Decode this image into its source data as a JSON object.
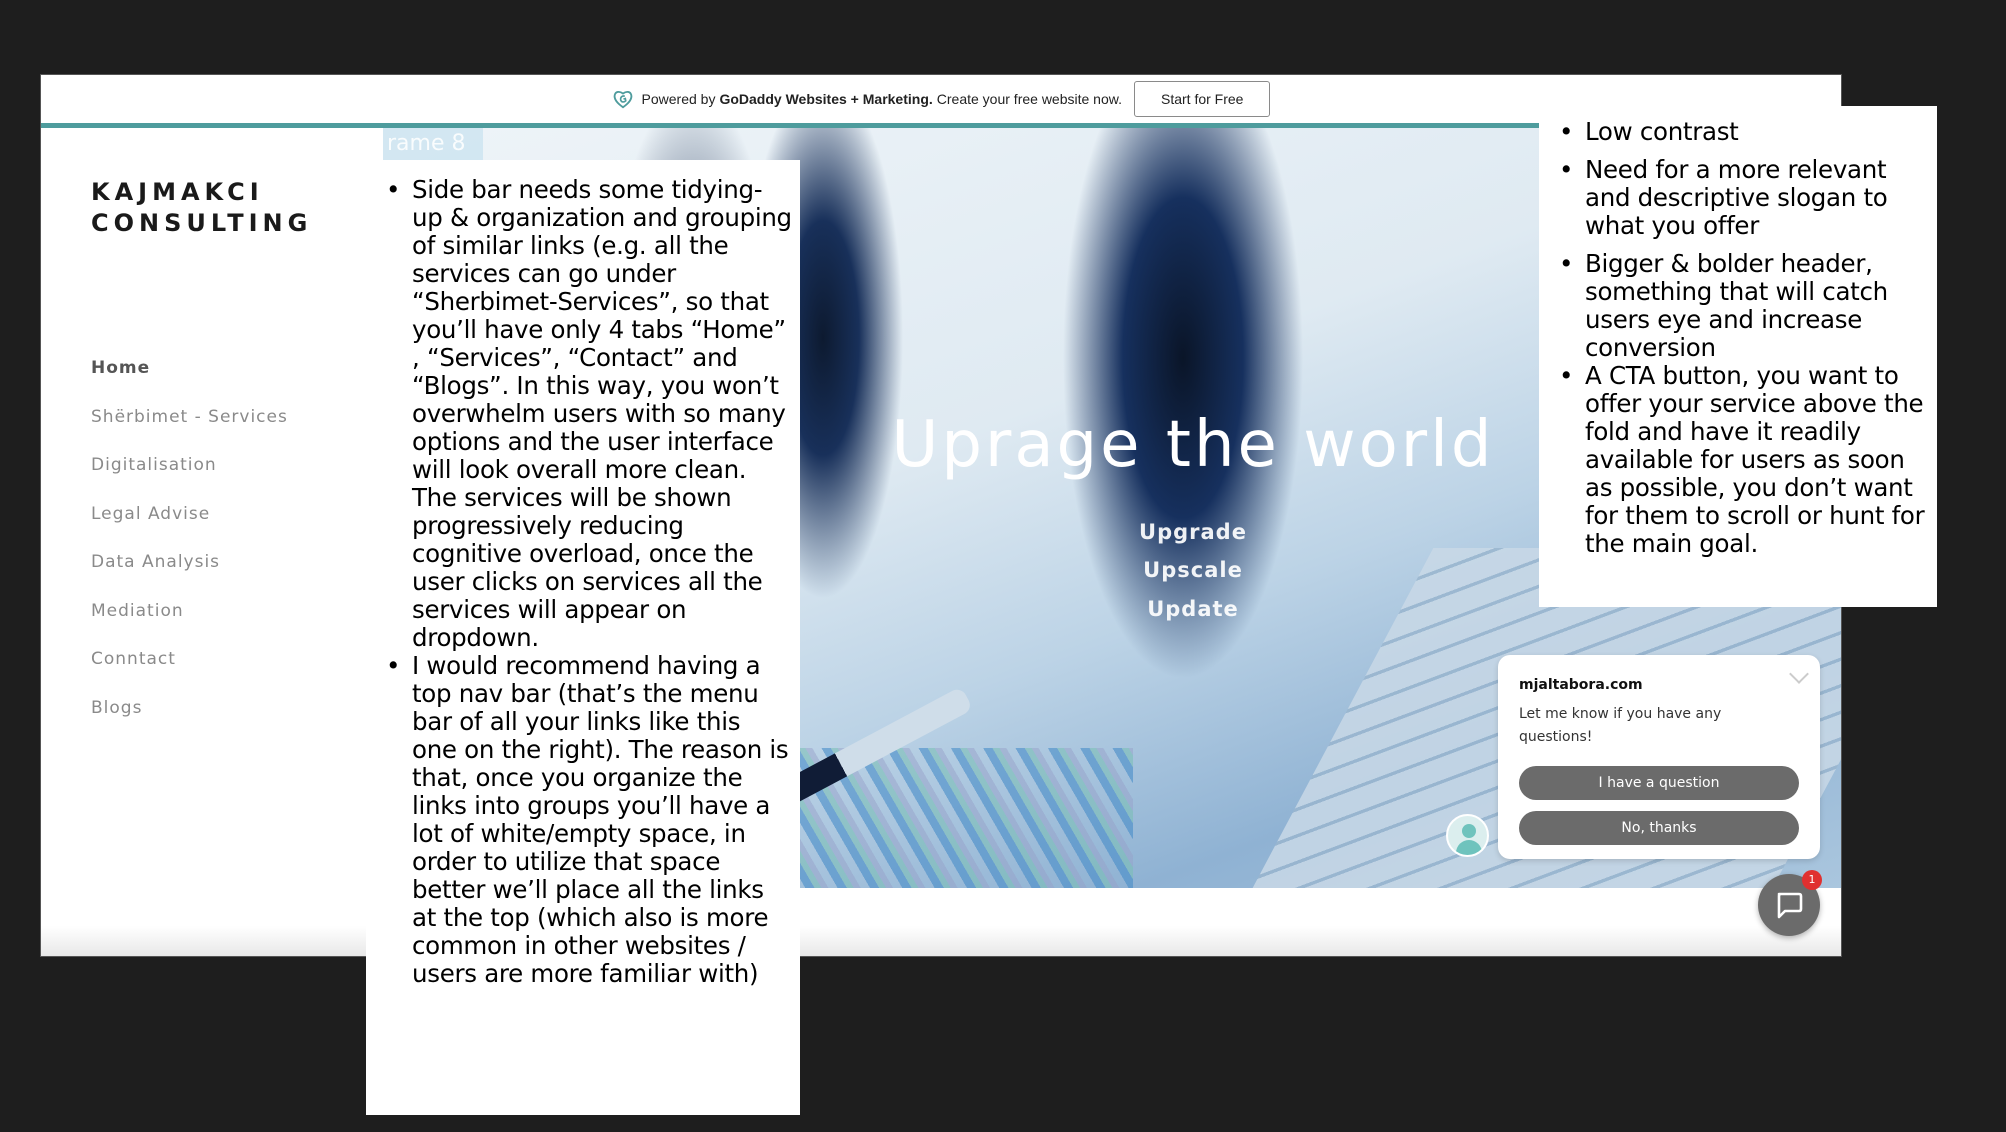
{
  "banner": {
    "powered_prefix": "Powered by",
    "brand_bold": "GoDaddy Websites + Marketing.",
    "powered_suffix": "Create your free website now.",
    "start_button": "Start for Free",
    "logo_icon": "godaddy-heart-icon"
  },
  "colors": {
    "accent_teal": "#4e9c9d",
    "background": "#1e1e1e",
    "chat_button": "#6b6b6b",
    "badge": "#e03030"
  },
  "sidebar": {
    "brand_line1": "KAJMAKCI",
    "brand_line2": "CONSULTING",
    "items": [
      {
        "label": "Home",
        "active": true
      },
      {
        "label": "Shërbimet - Services"
      },
      {
        "label": "Digitalisation"
      },
      {
        "label": "Legal Advise"
      },
      {
        "label": "Data Analysis"
      },
      {
        "label": "Mediation"
      },
      {
        "label": "Conntact"
      },
      {
        "label": "Blogs"
      }
    ]
  },
  "hero": {
    "frame_label": "rame 8",
    "title": "Uprage the world",
    "subtitles": [
      "Upgrade",
      "Upscale",
      "Update"
    ]
  },
  "chat": {
    "site_name": "mjaltabora.com",
    "message": "Let me know if you have any questions!",
    "button_question": "I have a question",
    "button_decline": "No, thanks",
    "badge_count": "1"
  },
  "notes_left": [
    "Side bar needs some tidying-up & organization and grouping of similar links (e.g. all the services can go under “Sherbimet-Services”, so that you’ll have only 4 tabs “Home” , “Services”, “Contact” and “Blogs”. In this way, you won’t overwhelm users with so many options and the user interface will look overall more clean. The services will be shown progressively reducing cognitive overload, once the user clicks on services all the services will appear on dropdown.",
    "I would recommend having a top nav bar (that’s the menu bar of all your links like this one on the right). The reason is that, once you organize the links into groups you’ll have a lot of white/empty space, in order to utilize that space better we’ll place all the links at the top (which also is more common in other websites / users are more familiar with)"
  ],
  "notes_right": [
    "Low contrast",
    "Need for a more relevant and descriptive slogan to what you offer",
    "Bigger & bolder header, something that will catch users eye and increase conversion",
    "A CTA button, you want to offer your service above the fold and have it readily available for users as soon as possible, you don’t want for them to scroll or hunt for the main goal."
  ]
}
